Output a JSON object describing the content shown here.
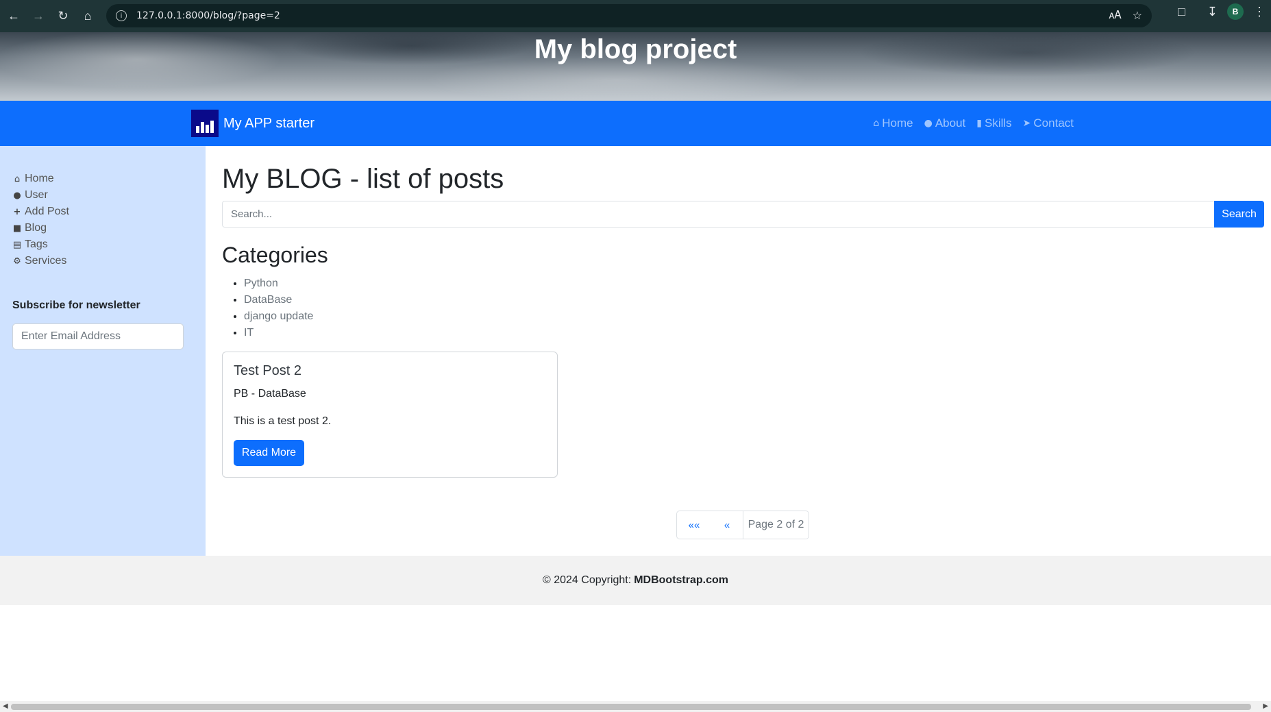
{
  "browser": {
    "url": "127.0.0.1:8000/blog/?page=2",
    "avatar_letter": "B",
    "icons": [
      "back-icon",
      "forward-icon",
      "reload-icon",
      "home-icon",
      "site-info-icon",
      "translate-icon",
      "star-icon",
      "extensions-icon",
      "download-icon",
      "menu-icon"
    ]
  },
  "hero": {
    "title": "My blog project"
  },
  "navbar": {
    "brand": "My APP starter",
    "links": [
      {
        "label": "Home",
        "icon": "home-icon"
      },
      {
        "label": "About",
        "icon": "user-icon"
      },
      {
        "label": "Skills",
        "icon": "book-icon"
      },
      {
        "label": "Contact",
        "icon": "paper-plane-icon"
      }
    ]
  },
  "sidebar": {
    "items": [
      {
        "label": "Home",
        "icon": "home-icon"
      },
      {
        "label": "User",
        "icon": "user-icon"
      },
      {
        "label": "Add Post",
        "icon": "plus-icon"
      },
      {
        "label": "Blog",
        "icon": "sticky-note-icon"
      },
      {
        "label": "Tags",
        "icon": "briefcase-icon"
      },
      {
        "label": "Services",
        "icon": "gears-icon"
      }
    ],
    "newsletter_title": "Subscribe for newsletter",
    "newsletter_placeholder": "Enter Email Address"
  },
  "main": {
    "title": "My BLOG - list of posts",
    "search_placeholder": "Search...",
    "search_button": "Search",
    "categories_title": "Categories",
    "categories": [
      "Python",
      "DataBase",
      "django update",
      "IT"
    ],
    "posts": [
      {
        "title": "Test Post 2",
        "meta": "PB - DataBase",
        "body": "This is a test post 2.",
        "button": "Read More"
      }
    ],
    "pagination": {
      "first": "««",
      "prev": "«",
      "info": "Page 2 of 2"
    }
  },
  "footer": {
    "text": "© 2024 Copyright:",
    "link": "MDBootstrap.com"
  },
  "colors": {
    "primary": "#0d6efd",
    "sidebar": "#cfe2ff",
    "footer": "#f2f2f2"
  }
}
